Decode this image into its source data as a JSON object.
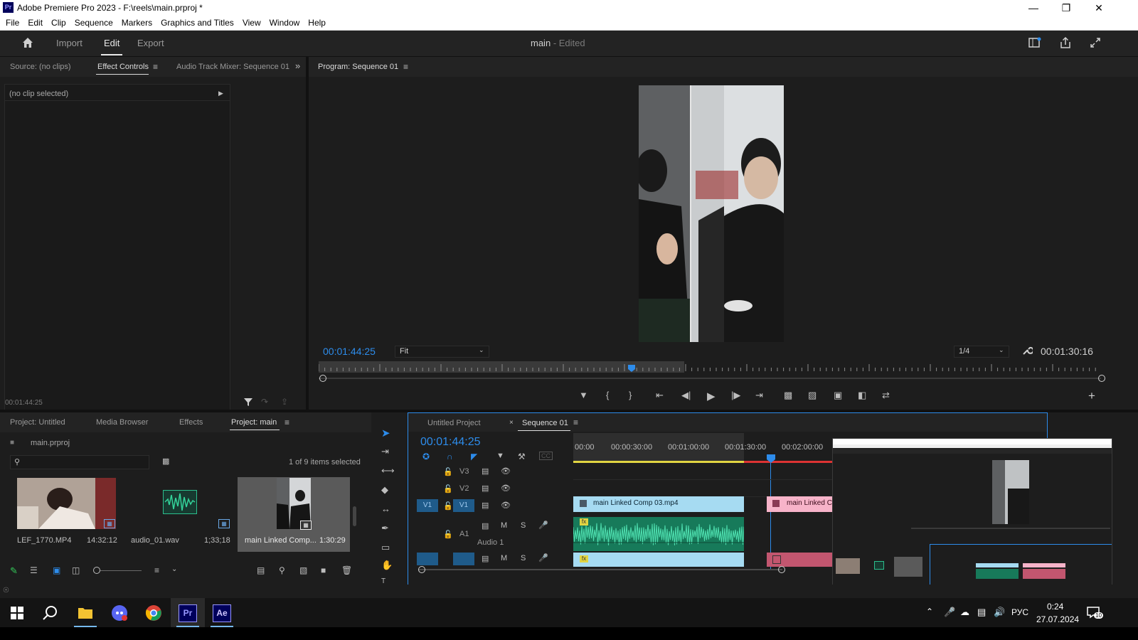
{
  "window": {
    "app_icon": "Pr",
    "title": "Adobe Premiere Pro 2023 - F:\\reels\\main.prproj *",
    "controls": [
      "minimize",
      "maximize",
      "close"
    ]
  },
  "menu": [
    "File",
    "Edit",
    "Clip",
    "Sequence",
    "Markers",
    "Graphics and Titles",
    "View",
    "Window",
    "Help"
  ],
  "header": {
    "tabs": [
      "Import",
      "Edit",
      "Export"
    ],
    "active_tab": "Edit",
    "project_name": "main",
    "project_status": "- Edited"
  },
  "source_panel": {
    "tabs": [
      "Source: (no clips)",
      "Effect Controls",
      "Audio Track Mixer: Sequence 01"
    ],
    "active_tab": "Effect Controls",
    "no_clip": "(no clip selected)",
    "timecode": "00:01:44:25"
  },
  "program": {
    "title": "Program: Sequence 01",
    "timecode": "00:01:44:25",
    "fit": "Fit",
    "resolution": "1/4",
    "duration": "00:01:30:16",
    "playhead_position": 0.4
  },
  "project_panel": {
    "tabs": [
      "Project: Untitled",
      "Media Browser",
      "Effects",
      "Project: main"
    ],
    "active_tab": "Project: main",
    "file": "main.prproj",
    "search_placeholder": "",
    "items_info": "1 of 9 items selected",
    "items": [
      {
        "name": "LEF_1770.MP4",
        "duration": "14:32:12"
      },
      {
        "name": "audio_01.wav",
        "duration": "1;33;18"
      },
      {
        "name": "main Linked Comp...",
        "duration": "1:30:29"
      }
    ]
  },
  "timeline": {
    "tabs": [
      "Untitled Project",
      "Sequence 01"
    ],
    "active_tab": "Sequence 01",
    "timecode": "00:01:44:25",
    "ruler": [
      "00:00",
      "00:00:30:00",
      "00:01:00:00",
      "00:01:30:00",
      "00:02:00:00"
    ],
    "tracks": {
      "v3": "V3",
      "v2": "V2",
      "v1": "V1",
      "v1_src": "V1",
      "a1": "A1",
      "a1_name": "Audio 1",
      "mute": "M",
      "solo": "S"
    },
    "clips": {
      "video_main": "main Linked Comp 03.mp4",
      "video_second": "main Linked Co",
      "fx": "fx"
    }
  },
  "taskbar": {
    "lang": "РУС",
    "time": "0:24",
    "date": "27.07.2024",
    "notif_count": "10",
    "ae_label": "Ae",
    "pr_label": "Pr"
  }
}
